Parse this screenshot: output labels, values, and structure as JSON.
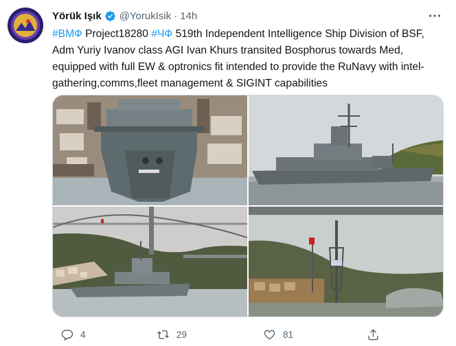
{
  "tweet": {
    "author_name": "Yörük Işık",
    "handle": "@YorukIsik",
    "separator": "·",
    "time": "14h",
    "text": {
      "tag1": "#ВМФ",
      "part1": " Project18280 ",
      "tag2": "#ЧФ",
      "part2": " 519th Independent Intelligence Ship Division of BSF, Adm Yuriy Ivanov class AGI Ivan Khurs transited Bosphorus towards Med, equipped with full EW & optronics fit intended to provide the RuNavy with intel-gathering,comms,fleet management & SIGINT capabilities"
    },
    "media": [
      {
        "icon": "ship-bow-photo"
      },
      {
        "icon": "ship-side-photo"
      },
      {
        "icon": "bridge-ship-photo"
      },
      {
        "icon": "ship-mast-photo"
      }
    ],
    "actions": {
      "reply": {
        "icon": "reply-icon",
        "count": "4"
      },
      "retweet": {
        "icon": "retweet-icon",
        "count": "29"
      },
      "like": {
        "icon": "like-icon",
        "count": "81"
      },
      "share": {
        "icon": "share-icon"
      }
    }
  },
  "colors": {
    "link": "#1d9bf0",
    "secondary_text": "#536471",
    "verified": "#1d9bf0"
  }
}
